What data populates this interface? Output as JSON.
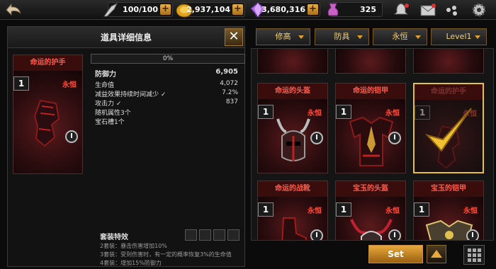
{
  "topbar": {
    "stamina": "100/100",
    "gold": "2,937,104",
    "gems": "3,680,316",
    "potion": "325",
    "icons": [
      "back-arrow-icon",
      "stamina-icon",
      "gold-coin-icon",
      "gem-icon",
      "potion-icon",
      "bell-icon",
      "mail-icon",
      "chat-icon",
      "gear-icon"
    ]
  },
  "detail": {
    "title": "道具详细信息",
    "close_label": "✕",
    "item": {
      "name": "命运的护手",
      "level": "1",
      "tier": "永恒",
      "info_label": "I"
    },
    "progress": "0%",
    "main_stat": {
      "label": "防御力",
      "value": "6,905"
    },
    "substats": [
      {
        "label": "生命值",
        "value": "4,072"
      },
      {
        "label": "减益效果持续时间减少 ✓",
        "value": "7.2%"
      },
      {
        "label": "攻击力 ✓",
        "value": "837"
      },
      {
        "label": "随机属性3个",
        "value": ""
      },
      {
        "label": "宝石槽1个",
        "value": ""
      }
    ],
    "set_title": "套装特效",
    "set_lines": [
      "2套装：暴击伤害增加10%",
      "3套装：受到伤害时，有一定的概率恢复3%的生命值",
      "4套装：增加15%防御力"
    ]
  },
  "filters": {
    "grade": "修高",
    "type": "防具",
    "tier": "永恒",
    "level": "Level1"
  },
  "grid": {
    "cards": [
      {
        "name": "命运的头盔",
        "level": "1",
        "tier": "永恒",
        "info": "I",
        "selected": false,
        "icon": "helmet-icon"
      },
      {
        "name": "命运的铠甲",
        "level": "1",
        "tier": "永恒",
        "info": "I",
        "selected": false,
        "icon": "armor-icon"
      },
      {
        "name": "命运的护手",
        "level": "1",
        "tier": "永恒",
        "info": "I",
        "selected": true,
        "icon": "gauntlet-icon"
      },
      {
        "name": "命运的战靴",
        "level": "1",
        "tier": "永恒",
        "info": "I",
        "selected": false,
        "icon": "boots-icon"
      },
      {
        "name": "宝玉的头盔",
        "level": "1",
        "tier": "永恒",
        "info": "I",
        "selected": false,
        "icon": "helmet-icon"
      },
      {
        "name": "宝玉的铠甲",
        "level": "1",
        "tier": "永恒",
        "info": "I",
        "selected": false,
        "icon": "armor-icon"
      }
    ]
  },
  "footer": {
    "set_label": "Set"
  },
  "colors": {
    "accent": "#e8a83a",
    "tier_red": "#ff4a3a",
    "card_name_red": "#ff5a4a",
    "selected_gold": "#e8c040"
  }
}
